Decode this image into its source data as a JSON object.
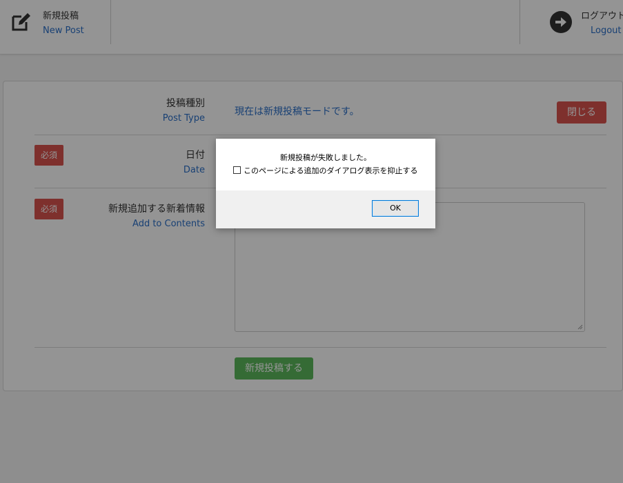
{
  "header": {
    "new_post": {
      "title": "新規投稿",
      "subtitle": "New Post",
      "icon": "edit-icon"
    },
    "logout": {
      "title": "ログアウト",
      "subtitle": "Logout",
      "icon": "arrow-right-circle-icon"
    }
  },
  "form": {
    "post_type": {
      "label": "投稿種別",
      "sublabel": "Post Type",
      "mode_text": "現在は新規投稿モードです。"
    },
    "close_label": "閉じる",
    "date": {
      "required": "必須",
      "label": "日付",
      "sublabel": "Date"
    },
    "contents": {
      "required": "必須",
      "label": "新規追加する新着情報",
      "sublabel": "Add to Contents",
      "value": ""
    },
    "submit_label": "新規投稿する"
  },
  "dialog": {
    "message": "新規投稿が失敗しました。",
    "checkbox_label": "このページによる追加のダイアログ表示を抑止する",
    "checkbox_checked": false,
    "ok_label": "OK"
  },
  "colors": {
    "required": "#d9534f",
    "close": "#d9534f",
    "submit": "#5cb85c",
    "link": "#2a6fc9",
    "ok_border": "#0078d7"
  }
}
